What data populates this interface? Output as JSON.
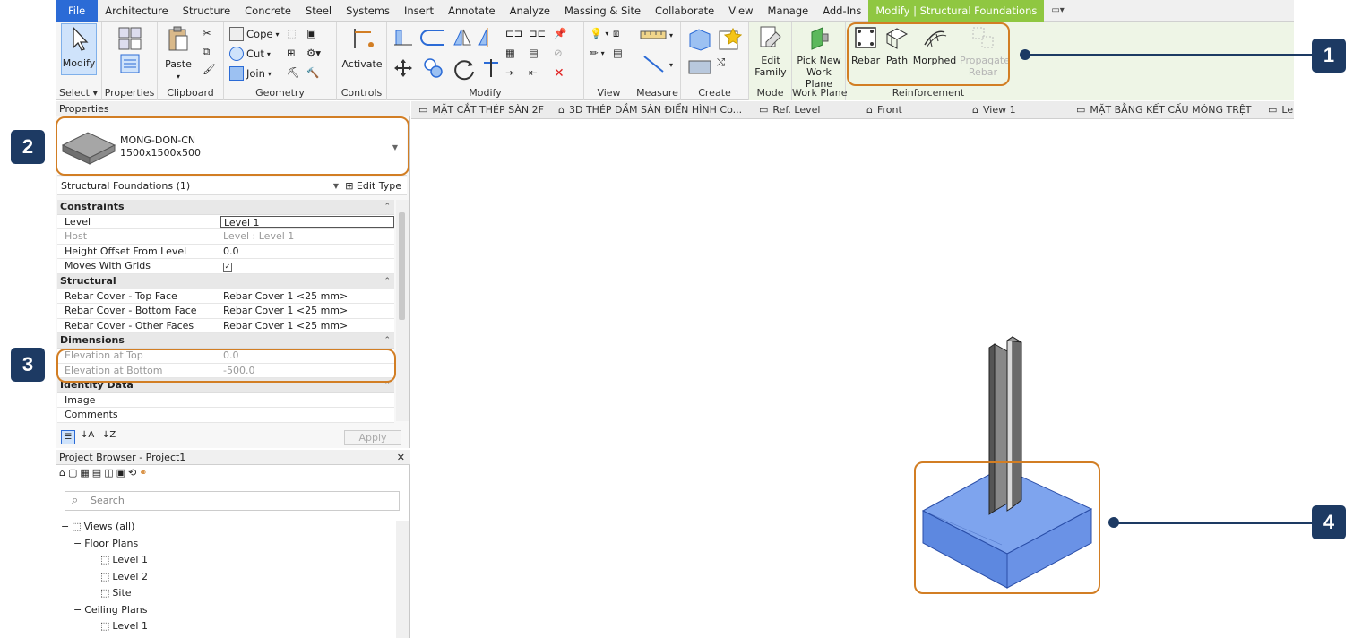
{
  "menu": {
    "tabs": [
      "File",
      "Architecture",
      "Structure",
      "Concrete",
      "Steel",
      "Systems",
      "Insert",
      "Annotate",
      "Analyze",
      "Massing & Site",
      "Collaborate",
      "View",
      "Manage",
      "Add-Ins",
      "Modify | Structural Foundations"
    ],
    "active_tab": "Modify | Structural Foundations"
  },
  "ribbon": {
    "modify_label": "Modify",
    "properties_label": "Properties",
    "paste_label": "Paste",
    "cope_label": "Cope",
    "cut_label": "Cut",
    "join_label": "Join",
    "activate_label": "Activate",
    "edit_family_label": "Edit Family",
    "pick_new_work_plane_label": "Pick New Work Plane",
    "rebar_label": "Rebar",
    "path_label": "Path",
    "morphed_label": "Morphed",
    "propagate_rebar_label": "Propagate Rebar",
    "panels": {
      "select": "Select",
      "properties": "Properties",
      "clipboard": "Clipboard",
      "geometry": "Geometry",
      "controls": "Controls",
      "modify": "Modify",
      "view": "View",
      "measure": "Measure",
      "create": "Create",
      "mode": "Mode",
      "work_plane": "Work Plane",
      "reinforcement": "Reinforcement"
    }
  },
  "properties": {
    "title": "Properties",
    "type_name": "MONG-DON-CN",
    "type_size": "1500x1500x500",
    "filter": "Structural Foundations (1)",
    "edit_type": "Edit Type",
    "groups": {
      "constraints": "Constraints",
      "structural": "Structural",
      "dimensions": "Dimensions",
      "identity": "Identity Data"
    },
    "rows": {
      "level_k": "Level",
      "level_v": "Level 1",
      "host_k": "Host",
      "host_v": "Level : Level 1",
      "offset_k": "Height Offset From Level",
      "offset_v": "0.0",
      "moves_k": "Moves With Grids",
      "top_k": "Rebar Cover - Top Face",
      "top_v": "Rebar Cover 1 <25 mm>",
      "bottom_k": "Rebar Cover - Bottom Face",
      "bottom_v": "Rebar Cover 1 <25 mm>",
      "other_k": "Rebar Cover - Other Faces",
      "other_v": "Rebar Cover 1 <25 mm>",
      "elev_top_k": "Elevation at Top",
      "elev_top_v": "0.0",
      "elev_bot_k": "Elevation at Bottom",
      "elev_bot_v": "-500.0",
      "image_k": "Image",
      "comments_k": "Comments"
    },
    "apply": "Apply"
  },
  "project_browser": {
    "title": "Project Browser - Project1",
    "search_placeholder": "Search",
    "views_all": "Views (all)",
    "floor_plans": "Floor Plans",
    "level1": "Level 1",
    "level2": "Level 2",
    "site": "Site",
    "ceiling_plans": "Ceiling Plans",
    "ceiling_level1": "Level 1"
  },
  "view_tabs": [
    "MẶT CẮT THÉP SÀN 2F",
    "3D THÉP DẦM SÀN ĐIỂN HÌNH Co...",
    "Ref. Level",
    "Front",
    "View 1",
    "MẶT BẰNG KẾT CẤU MÓNG TRỆT",
    "Le"
  ],
  "callouts": [
    "1",
    "2",
    "3",
    "4"
  ],
  "colors": {
    "accent_file": "#2b6bd6",
    "context_tab": "#8fc741",
    "callout_orange": "#d27e24",
    "badge_navy": "#1d3a63",
    "foundation_blue": "#6f95e8"
  }
}
